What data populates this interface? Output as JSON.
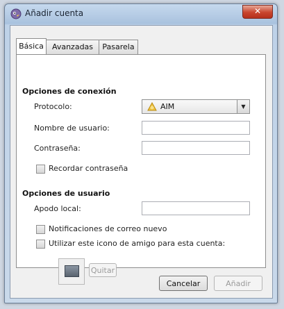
{
  "window": {
    "title": "Añadir cuenta",
    "close_glyph": "✕"
  },
  "tabs": [
    {
      "label": "Básica",
      "active": true
    },
    {
      "label": "Avanzadas",
      "active": false
    },
    {
      "label": "Pasarela",
      "active": false
    }
  ],
  "connection": {
    "heading": "Opciones de conexión",
    "protocol_label": "Protocolo:",
    "protocol_value": "AIM",
    "protocol_icon": "aim-protocol-icon",
    "username_label": "Nombre de usuario:",
    "username_value": "",
    "password_label": "Contraseña:",
    "password_value": "",
    "remember_password_label": "Recordar contraseña",
    "remember_password_checked": false
  },
  "user": {
    "heading": "Opciones de usuario",
    "alias_label": "Apodo local:",
    "alias_value": "",
    "new_mail_label": "Notificaciones de correo nuevo",
    "new_mail_checked": false,
    "buddy_icon_label": "Utilizar este icono de amigo para esta cuenta:",
    "buddy_icon_checked": false,
    "remove_label": "Quitar"
  },
  "buttons": {
    "cancel": "Cancelar",
    "add": "Añadir"
  },
  "colors": {
    "titlebar": "#b9cde6",
    "close_button": "#c9452e",
    "panel": "#ffffff"
  }
}
